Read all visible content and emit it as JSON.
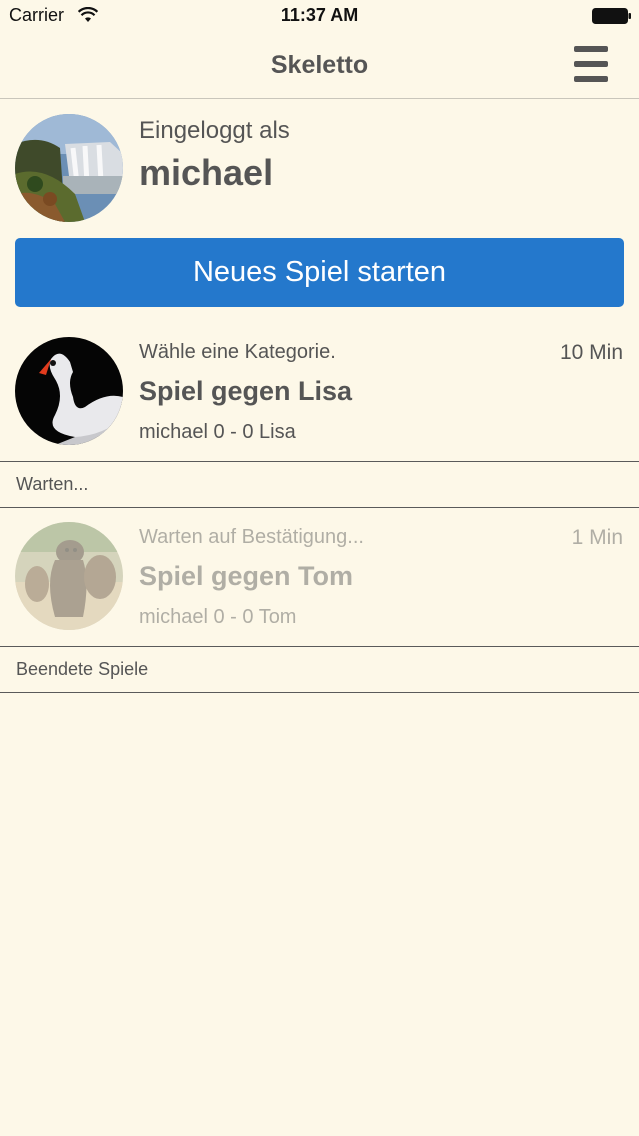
{
  "status_bar": {
    "carrier": "Carrier",
    "time": "11:37 AM"
  },
  "nav": {
    "title": "Skeletto"
  },
  "profile": {
    "logged_in_label": "Eingeloggt als",
    "username": "michael"
  },
  "new_game_button": "Neues Spiel starten",
  "active_games": [
    {
      "status": "Wähle eine Kategorie.",
      "time": "10 Min",
      "title": "Spiel gegen Lisa",
      "score": "michael 0 - 0 Lisa"
    }
  ],
  "sections": {
    "waiting": "Warten...",
    "finished": "Beendete Spiele"
  },
  "waiting_games": [
    {
      "status": "Warten auf Bestätigung...",
      "time": "1 Min",
      "title": "Spiel gegen Tom",
      "score": "michael 0 - 0 Tom"
    }
  ],
  "colors": {
    "background": "#fdf8e8",
    "button": "#2478cc",
    "text": "#555555"
  }
}
